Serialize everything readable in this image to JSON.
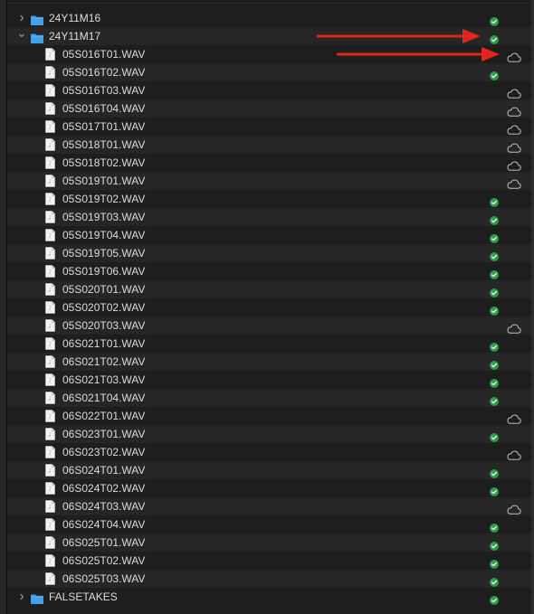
{
  "colors": {
    "synced_green": "#2e9e4b",
    "folder_blue": "#3fa3e8",
    "arrow_red": "#e3261b"
  },
  "icons": {
    "folder": "folder-icon",
    "audio_file": "audio-file-icon",
    "synced": "synced-checkmark-icon",
    "cloud": "cloud-only-icon",
    "expand": "chevron-right-icon",
    "collapse": "chevron-down-icon"
  },
  "rows": [
    {
      "kind": "folder",
      "name": "24Y11M16",
      "status": "synced",
      "expanded": false
    },
    {
      "kind": "folder",
      "name": "24Y11M17",
      "status": "synced",
      "expanded": true
    },
    {
      "kind": "file",
      "name": "05S016T01.WAV",
      "status": "cloud"
    },
    {
      "kind": "file",
      "name": "05S016T02.WAV",
      "status": "synced"
    },
    {
      "kind": "file",
      "name": "05S016T03.WAV",
      "status": "cloud"
    },
    {
      "kind": "file",
      "name": "05S016T04.WAV",
      "status": "cloud"
    },
    {
      "kind": "file",
      "name": "05S017T01.WAV",
      "status": "cloud"
    },
    {
      "kind": "file",
      "name": "05S018T01.WAV",
      "status": "cloud"
    },
    {
      "kind": "file",
      "name": "05S018T02.WAV",
      "status": "cloud"
    },
    {
      "kind": "file",
      "name": "05S019T01.WAV",
      "status": "cloud"
    },
    {
      "kind": "file",
      "name": "05S019T02.WAV",
      "status": "synced"
    },
    {
      "kind": "file",
      "name": "05S019T03.WAV",
      "status": "synced"
    },
    {
      "kind": "file",
      "name": "05S019T04.WAV",
      "status": "synced"
    },
    {
      "kind": "file",
      "name": "05S019T05.WAV",
      "status": "synced"
    },
    {
      "kind": "file",
      "name": "05S019T06.WAV",
      "status": "synced"
    },
    {
      "kind": "file",
      "name": "05S020T01.WAV",
      "status": "synced"
    },
    {
      "kind": "file",
      "name": "05S020T02.WAV",
      "status": "synced"
    },
    {
      "kind": "file",
      "name": "05S020T03.WAV",
      "status": "cloud"
    },
    {
      "kind": "file",
      "name": "06S021T01.WAV",
      "status": "synced"
    },
    {
      "kind": "file",
      "name": "06S021T02.WAV",
      "status": "synced"
    },
    {
      "kind": "file",
      "name": "06S021T03.WAV",
      "status": "synced"
    },
    {
      "kind": "file",
      "name": "06S021T04.WAV",
      "status": "synced"
    },
    {
      "kind": "file",
      "name": "06S022T01.WAV",
      "status": "cloud"
    },
    {
      "kind": "file",
      "name": "06S023T01.WAV",
      "status": "synced"
    },
    {
      "kind": "file",
      "name": "06S023T02.WAV",
      "status": "cloud"
    },
    {
      "kind": "file",
      "name": "06S024T01.WAV",
      "status": "synced"
    },
    {
      "kind": "file",
      "name": "06S024T02.WAV",
      "status": "synced"
    },
    {
      "kind": "file",
      "name": "06S024T03.WAV",
      "status": "cloud"
    },
    {
      "kind": "file",
      "name": "06S024T04.WAV",
      "status": "synced"
    },
    {
      "kind": "file",
      "name": "06S025T01.WAV",
      "status": "synced"
    },
    {
      "kind": "file",
      "name": "06S025T02.WAV",
      "status": "synced"
    },
    {
      "kind": "file",
      "name": "06S025T03.WAV",
      "status": "synced"
    },
    {
      "kind": "folder",
      "name": "FALSETAKES",
      "status": "synced",
      "expanded": false
    }
  ],
  "annotations": [
    {
      "type": "arrow",
      "points_to_row": 1,
      "color": "arrow_red"
    },
    {
      "type": "arrow",
      "points_to_row": 2,
      "color": "arrow_red"
    }
  ]
}
